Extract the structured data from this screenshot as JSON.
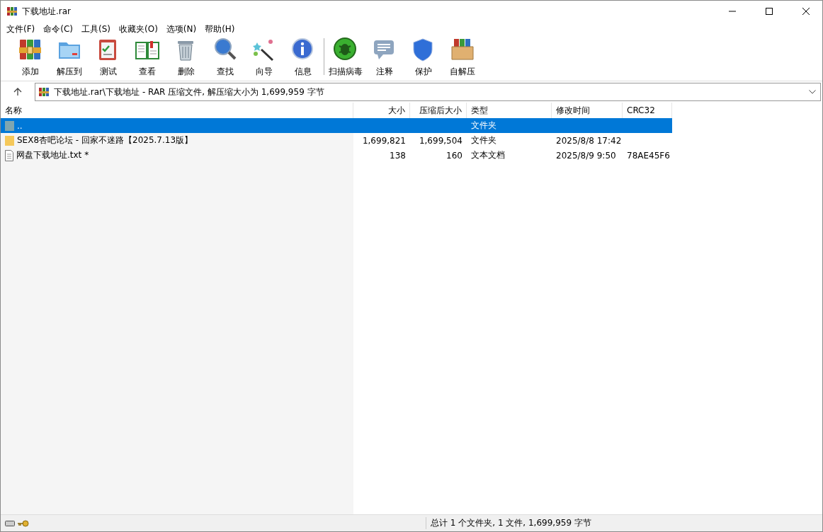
{
  "window": {
    "title": "下载地址.rar"
  },
  "menu": [
    "文件(F)",
    "命令(C)",
    "工具(S)",
    "收藏夹(O)",
    "选项(N)",
    "帮助(H)"
  ],
  "toolbar": [
    {
      "label": "添加",
      "kind": "add"
    },
    {
      "label": "解压到",
      "kind": "extract"
    },
    {
      "label": "测试",
      "kind": "test"
    },
    {
      "label": "查看",
      "kind": "view"
    },
    {
      "label": "删除",
      "kind": "delete"
    },
    {
      "label": "查找",
      "kind": "find"
    },
    {
      "label": "向导",
      "kind": "wizard"
    },
    {
      "label": "信息",
      "kind": "info"
    },
    {
      "label": "扫描病毒",
      "kind": "scan",
      "separator_before": true
    },
    {
      "label": "注释",
      "kind": "comment"
    },
    {
      "label": "保护",
      "kind": "protect"
    },
    {
      "label": "自解压",
      "kind": "sfx"
    }
  ],
  "address": {
    "path": "下载地址.rar\\下载地址 - RAR 压缩文件, 解压缩大小为 1,699,959 字节"
  },
  "table": {
    "columns": [
      "名称",
      "大小",
      "压缩后大小",
      "类型",
      "修改时间",
      "CRC32"
    ],
    "rows": [
      {
        "kind": "parent",
        "selected": true,
        "cells": [
          "..",
          "",
          "",
          "文件夹",
          "",
          ""
        ]
      },
      {
        "kind": "folder",
        "selected": false,
        "cells": [
          "SEX8杏吧论坛 - 回家不迷路【2025.7.13版】",
          "1,699,821",
          "1,699,504",
          "文件夹",
          "2025/8/8 17:42",
          ""
        ]
      },
      {
        "kind": "file",
        "selected": false,
        "cells": [
          "网盘下载地址.txt *",
          "138",
          "160",
          "文本文档",
          "2025/8/9 9:50",
          "78AE45F6"
        ]
      }
    ]
  },
  "status_bar": {
    "text": "总计 1 个文件夹, 1 文件, 1,699,959 字节"
  }
}
